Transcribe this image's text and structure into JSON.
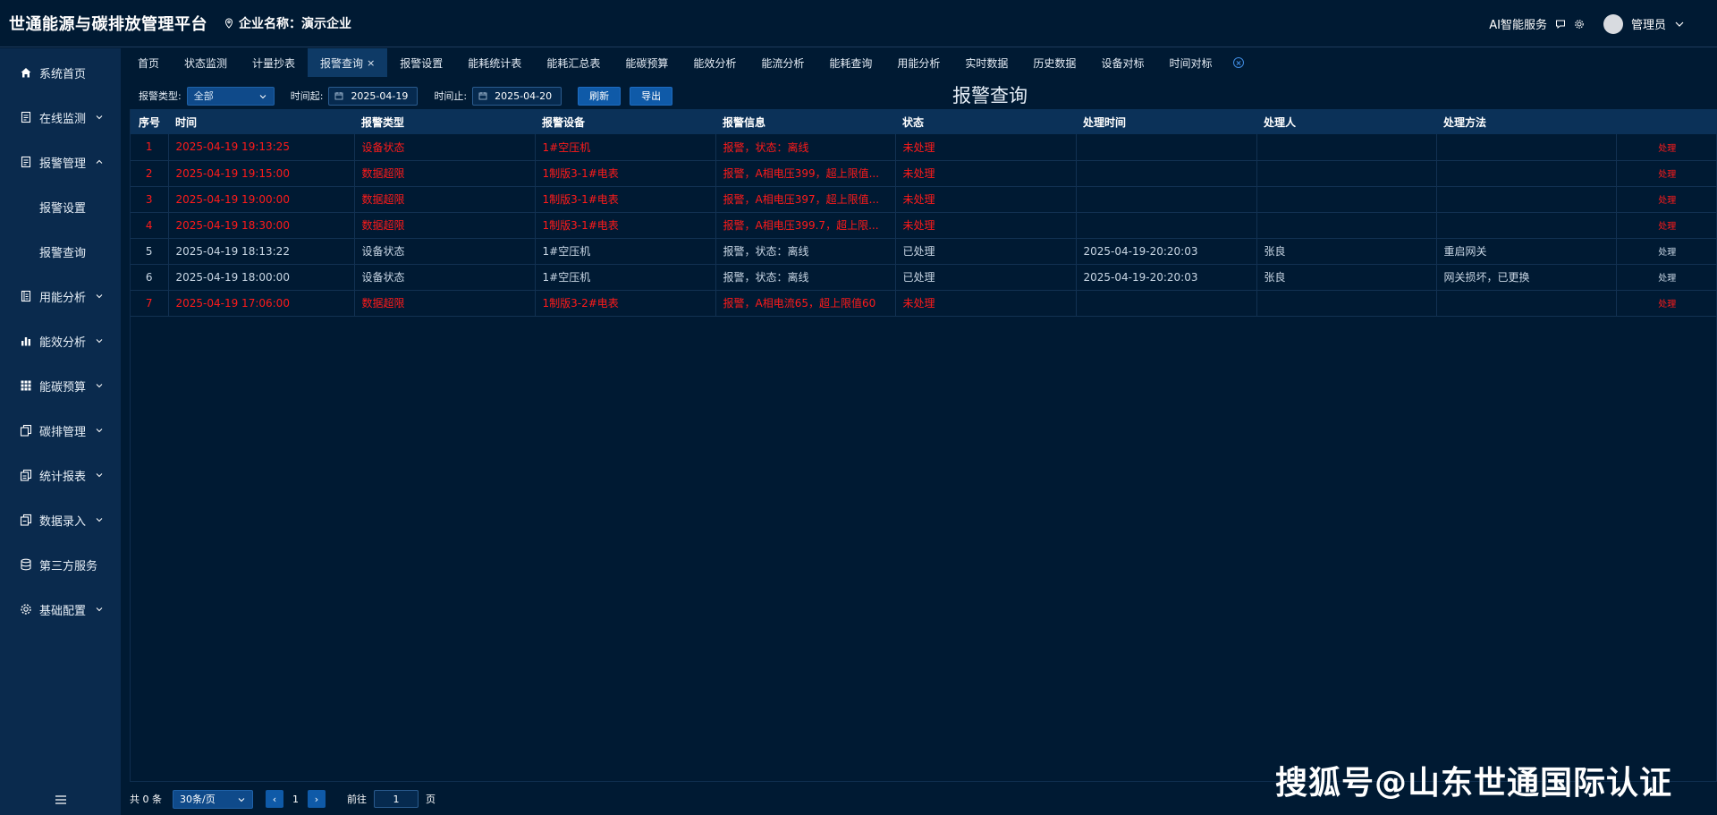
{
  "header": {
    "app_title": "世通能源与碳排放管理平台",
    "company_label": "企业名称：",
    "company_name": "演示企业",
    "ai_service": "AI智能服务",
    "user": "管理员"
  },
  "sidebar": {
    "items": [
      {
        "label": "系统首页",
        "icon": "home-icon"
      },
      {
        "label": "在线监测",
        "icon": "monitor-doc-icon"
      },
      {
        "label": "报警管理",
        "icon": "alarm-doc-icon"
      },
      {
        "label": "报警设置"
      },
      {
        "label": "报警查询"
      },
      {
        "label": "用能分析",
        "icon": "usage-doc-icon"
      },
      {
        "label": "能效分析",
        "icon": "bar-chart-icon"
      },
      {
        "label": "能碳预算",
        "icon": "grid-icon"
      },
      {
        "label": "碳排管理",
        "icon": "copy-icon"
      },
      {
        "label": "统计报表",
        "icon": "report-icon"
      },
      {
        "label": "数据录入",
        "icon": "input-icon"
      },
      {
        "label": "第三方服务",
        "icon": "database-icon"
      },
      {
        "label": "基础配置",
        "icon": "gear-icon"
      }
    ]
  },
  "tabs": [
    "首页",
    "状态监测",
    "计量抄表",
    "报警查询",
    "报警设置",
    "能耗统计表",
    "能耗汇总表",
    "能碳预算",
    "能效分析",
    "能流分析",
    "能耗查询",
    "用能分析",
    "实时数据",
    "历史数据",
    "设备对标",
    "时间对标"
  ],
  "tabs_close": "×",
  "filters": {
    "type_label": "报警类型:",
    "type_value": "全部",
    "start_label": "时间起:",
    "start_value": "2025-04-19",
    "end_label": "时间止:",
    "end_value": "2025-04-20",
    "refresh": "刷新",
    "export": "导出"
  },
  "page_title": "报警查询",
  "table": {
    "columns": [
      "序号",
      "时间",
      "报警类型",
      "报警设备",
      "报警信息",
      "状态",
      "处理时间",
      "处理人",
      "处理方法",
      ""
    ],
    "rows": [
      {
        "no": "1",
        "time": "2025-04-19 19:13:25",
        "type": "设备状态",
        "device": "1#空压机",
        "info": "报警，状态：离线",
        "status": "未处理",
        "handle_time": "",
        "handler": "",
        "method": "",
        "action": "处理",
        "alarm": true
      },
      {
        "no": "2",
        "time": "2025-04-19 19:15:00",
        "type": "数据超限",
        "device": "1制版3-1#电表",
        "info": "报警，A相电压399，超上限值...",
        "status": "未处理",
        "handle_time": "",
        "handler": "",
        "method": "",
        "action": "处理",
        "alarm": true
      },
      {
        "no": "3",
        "time": "2025-04-19 19:00:00",
        "type": "数据超限",
        "device": "1制版3-1#电表",
        "info": "报警，A相电压397，超上限值...",
        "status": "未处理",
        "handle_time": "",
        "handler": "",
        "method": "",
        "action": "处理",
        "alarm": true
      },
      {
        "no": "4",
        "time": "2025-04-19 18:30:00",
        "type": "数据超限",
        "device": "1制版3-1#电表",
        "info": "报警，A相电压399.7，超上限...",
        "status": "未处理",
        "handle_time": "",
        "handler": "",
        "method": "",
        "action": "处理",
        "alarm": true
      },
      {
        "no": "5",
        "time": "2025-04-19 18:13:22",
        "type": "设备状态",
        "device": "1#空压机",
        "info": "报警，状态：离线",
        "status": "已处理",
        "handle_time": "2025-04-19-20:20:03",
        "handler": "张良",
        "method": "重启网关",
        "action": "处理",
        "alarm": false
      },
      {
        "no": "6",
        "time": "2025-04-19 18:00:00",
        "type": "设备状态",
        "device": "1#空压机",
        "info": "报警，状态：离线",
        "status": "已处理",
        "handle_time": "2025-04-19-20:20:03",
        "handler": "张良",
        "method": "网关损坏，已更换",
        "action": "处理",
        "alarm": false
      },
      {
        "no": "7",
        "time": "2025-04-19 17:06:00",
        "type": "数据超限",
        "device": "1制版3-2#电表",
        "info": "报警，A相电流65，超上限值60",
        "status": "未处理",
        "handle_time": "",
        "handler": "",
        "method": "",
        "action": "处理",
        "alarm": true
      }
    ]
  },
  "pager": {
    "total": "共 0 条",
    "page_size": "30条/页",
    "prev": "‹",
    "current": "1",
    "next": "›",
    "goto_label": "前往",
    "goto_value": "1",
    "page_unit": "页"
  },
  "watermark": "搜狐号@山东世通国际认证",
  "colors": {
    "alarm": "#ff1a1a",
    "action": "#1eb0a8",
    "accent": "#0f5aa8"
  }
}
